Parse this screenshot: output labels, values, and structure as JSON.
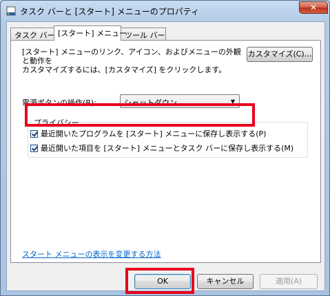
{
  "window": {
    "title": "タスク バーと [スタート] メニューのプロパティ",
    "close_glyph": "✕"
  },
  "tabs": [
    {
      "label": "タスク バー"
    },
    {
      "label": "[スタート] メニュー"
    },
    {
      "label": "ツール バー"
    }
  ],
  "panel": {
    "description_line1": "[スタート] メニューのリンク、アイコン、およびメニューの外観と動作を",
    "description_line2": "カスタマイズするには、[カスタマイズ] をクリックします。",
    "customize_button": "カスタマイズ(C)...",
    "power_label": "電源ボタンの操作(B):",
    "power_value": "シャットダウン",
    "privacy_group": "プライバシー",
    "check1_label": "最近開いたプログラムを [スタート] メニューに保存し表示する(P)",
    "check1_checked": true,
    "check2_label": "最近開いた項目を [スタート] メニューとタスク バーに保存し表示する(M)",
    "check2_checked": true,
    "help_link": "スタート メニューの表示を変更する方法"
  },
  "buttons": {
    "ok": "OK",
    "cancel": "キャンセル",
    "apply": "適用(A)"
  },
  "colors": {
    "highlight": "#e8001c",
    "link": "#0066cc"
  }
}
